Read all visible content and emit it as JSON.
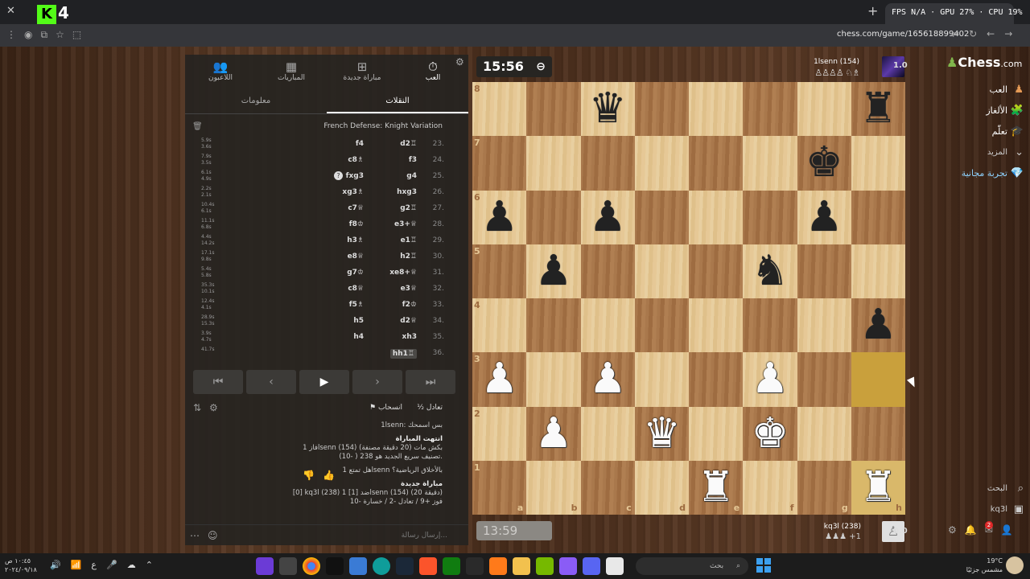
{
  "browser": {
    "tab_close": "✕",
    "brand": {
      "k": "K",
      "n": "4"
    },
    "new_tab": "+",
    "perf": "FPS N/A · GPU 27% · CPU 19%",
    "url": "chess.com/game/165618899402"
  },
  "panel": {
    "nav": [
      {
        "label": "العب",
        "icon": "⏱",
        "active": true
      },
      {
        "label": "مباراة جديدة",
        "icon": "⊞",
        "active": false
      },
      {
        "label": "المباريات",
        "icon": "▦",
        "active": false
      },
      {
        "label": "اللاعبون",
        "icon": "👥",
        "active": false
      }
    ],
    "subtabs": [
      {
        "label": "النقلات",
        "active": true
      },
      {
        "label": "معلومات",
        "active": false
      }
    ],
    "opening": "French Defense: Knight Variation",
    "moves": [
      {
        "num": "23.",
        "white": "d2♖",
        "black": "f4",
        "t1": "5.9s",
        "t2": "3.6s"
      },
      {
        "num": "24.",
        "white": "f3",
        "black": "c8♗",
        "t1": "7.9s",
        "t2": "3.5s"
      },
      {
        "num": "25.",
        "white": "g4",
        "black": "fxg3",
        "t1": "6.1s",
        "t2": "4.9s"
      },
      {
        "num": "26.",
        "white": "hxg3",
        "black": "xg3♗",
        "t1": "2.2s",
        "t2": "2.1s"
      },
      {
        "num": "27.",
        "white": "g2♖",
        "black": "c7♕",
        "t1": "10.4s",
        "t2": "6.1s"
      },
      {
        "num": "28.",
        "white": "e3+♕",
        "black": "f8♔",
        "t1": "11.1s",
        "t2": "6.8s"
      },
      {
        "num": "29.",
        "white": "e1♖",
        "black": "h3♗",
        "t1": "4.4s",
        "t2": "14.2s"
      },
      {
        "num": "30.",
        "white": "h2♖",
        "black": "e8♕",
        "t1": "17.1s",
        "t2": "9.8s"
      },
      {
        "num": "31.",
        "white": "xe8+♕",
        "black": "g7♔",
        "t1": "5.4s",
        "t2": "5.8s"
      },
      {
        "num": "32.",
        "white": "e3♕",
        "black": "c8♕",
        "t1": "35.3s",
        "t2": "10.1s"
      },
      {
        "num": "33.",
        "white": "f2♔",
        "black": "f5♗",
        "t1": "12.4s",
        "t2": "4.1s"
      },
      {
        "num": "34.",
        "white": "d2♕",
        "black": "h5",
        "t1": "28.9s",
        "t2": "15.3s"
      },
      {
        "num": "35.",
        "white": "xh3",
        "black": "h4",
        "t1": "3.9s",
        "t2": "4.7s"
      },
      {
        "num": "36.",
        "white": "hh1♖",
        "black": "",
        "t1": "41.7s",
        "t2": ""
      }
    ],
    "controls": [
      "⏮",
      "‹",
      "▶",
      "›",
      "⏭"
    ],
    "draw": "½ تعادل",
    "resign": "⚑ انسحاب",
    "chat": {
      "l1": "1lsenn: بس اسمحك",
      "l2": "انتهت المباراة",
      "l3": "فاز 1lsenn (154) بكش مات (20 دقيقة مصنفة)",
      "l4": "تصنيف سريع الجديد هو 238 ( -10).",
      "l5": "هل تمتع 1lsenn بالأخلاق الرياضية؟",
      "l6": "مباراة جديدة",
      "l7": "[0] kq3l (238) ضد [1] 1lsenn (154) (20 دقيقة)",
      "l8": "فوز +9 / تعادل -2 / خسارة -10"
    },
    "message_placeholder": "إرسال رسالة..."
  },
  "game": {
    "clock_top": "15:56",
    "clock_bottom": "13:59",
    "top_player": {
      "name": "1lsenn (154)",
      "captured": "♙♙♙♙ ♘♗",
      "score": "1.0"
    },
    "bottom_player": {
      "name": "kq3l (238)",
      "captured": "♟♟♟ +1",
      "score": "0.0"
    }
  },
  "board": {
    "files": [
      "a",
      "b",
      "c",
      "d",
      "e",
      "f",
      "g",
      "h"
    ],
    "ranks": [
      "8",
      "7",
      "6",
      "5",
      "4",
      "3",
      "2",
      "1"
    ],
    "position": [
      [
        "",
        "",
        "bq",
        "",
        "",
        "",
        "",
        "br"
      ],
      [
        "",
        "",
        "",
        "",
        "",
        "",
        "bk",
        ""
      ],
      [
        "bp",
        "",
        "bp",
        "",
        "",
        "",
        "bp",
        ""
      ],
      [
        "",
        "bp",
        "",
        "",
        "",
        "bn",
        "",
        ""
      ],
      [
        "",
        "",
        "",
        "",
        "",
        "",
        "",
        "bp"
      ],
      [
        "wp",
        "",
        "wp",
        "",
        "",
        "wp",
        "",
        ""
      ],
      [
        "",
        "wp",
        "",
        "wq",
        "",
        "wk",
        "",
        ""
      ],
      [
        "",
        "",
        "",
        "",
        "wr",
        "",
        "",
        "wr"
      ]
    ],
    "highlight": [
      "h3",
      "h1"
    ]
  },
  "sidebar": {
    "brand": "Chess",
    "brand_suffix": ".com",
    "items": [
      {
        "label": "العب",
        "icon": "♟"
      },
      {
        "label": "الألغاز",
        "icon": "🧩"
      },
      {
        "label": "تعلّم",
        "icon": "🎓"
      },
      {
        "label": "المزيد",
        "icon": "⌄"
      },
      {
        "label": "تجربة مجانية",
        "icon": "💎"
      }
    ],
    "search": "البحث",
    "user": "kq3l",
    "notif_count": "2"
  },
  "taskbar": {
    "time": "١٠:٤٥ ص",
    "date": "٢٠٢٤/٠٩/١٨",
    "search": "بحث",
    "temp": "19°C",
    "weather": "مشمس جزئيًا"
  }
}
